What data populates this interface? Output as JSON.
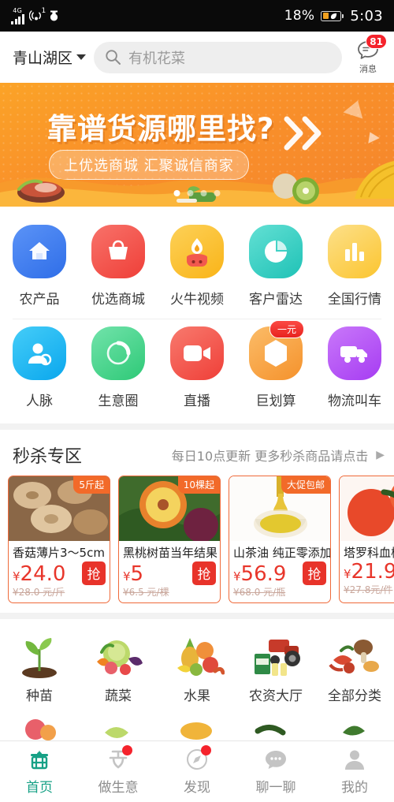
{
  "statusbar": {
    "network": "4G",
    "hotspot_count": "1",
    "battery_percent": "18%",
    "time": "5:03"
  },
  "header": {
    "location": "青山湖区",
    "location_caret_icon": "chevron-down-icon",
    "search_icon": "search-icon",
    "search_placeholder": "有机花菜",
    "search_value": "",
    "message_icon": "message-icon",
    "message_badge": "81",
    "message_label": "消息"
  },
  "banner": {
    "title": "靠谱货源哪里找?",
    "subtitle": "上优选商城 汇聚诚信商家",
    "arrow_icon": "double-chevron-right-icon",
    "dots": [
      "",
      "",
      "",
      ""
    ],
    "active_dot": 1,
    "bg_color": "#f9902a"
  },
  "quick_grid": {
    "rows": [
      [
        {
          "label": "农产品",
          "icon": "house-icon",
          "color1": "#3f7ff2",
          "color2": "#5b93f7"
        },
        {
          "label": "优选商城",
          "icon": "basket-icon",
          "color1": "#f4514a",
          "color2": "#f8726a"
        },
        {
          "label": "火牛视频",
          "icon": "bull-flame-icon",
          "color1": "#fcc223",
          "color2": "#fdd158"
        },
        {
          "label": "客户雷达",
          "icon": "pie-chart-icon",
          "color1": "#35d2c6",
          "color2": "#63e0d4"
        },
        {
          "label": "全国行情",
          "icon": "bar-chart-icon",
          "color1": "#fdcf3e",
          "color2": "#fde08a"
        }
      ],
      [
        {
          "label": "人脉",
          "icon": "contacts-icon",
          "color1": "#18b8f2",
          "color2": "#45cdf8"
        },
        {
          "label": "生意圈",
          "icon": "circle-ring-icon",
          "color1": "#3ed48a",
          "color2": "#72e3ab"
        },
        {
          "label": "直播",
          "icon": "video-camera-icon",
          "color1": "#f4514a",
          "color2": "#f87a6e"
        },
        {
          "label": "巨划算",
          "icon": "hexagon-icon",
          "color1": "#f79b39",
          "color2": "#fbbc68",
          "badge": "一元"
        },
        {
          "label": "物流叫车",
          "icon": "truck-icon",
          "color1": "#b14ff5",
          "color2": "#c978fa"
        }
      ]
    ]
  },
  "flash_sale": {
    "title": "秒杀专区",
    "subtitle": "每日10点更新 更多秒杀商品请点击",
    "arrow_icon": "chevron-right-icon",
    "buy_label": "抢",
    "items": [
      {
        "name": "香菇薄片3～5cm",
        "tag": "5斤起",
        "price": "24.0",
        "currency": "¥",
        "old_price": "¥28.0 元/斤",
        "img": "dried-mushroom-photo"
      },
      {
        "name": "黑桃树苗当年结果",
        "tag": "10棵起",
        "price": "5",
        "currency": "¥",
        "old_price": "¥6.5 元/棵",
        "img": "peach-photo"
      },
      {
        "name": "山茶油 纯正零添加",
        "tag": "大促包邮",
        "price": "56.9",
        "currency": "¥",
        "old_price": "¥68.0 元/瓶",
        "img": "camellia-oil-photo"
      },
      {
        "name": "塔罗科血橙",
        "tag": "",
        "price": "21.9",
        "currency": "¥",
        "old_price": "¥27.8元/件",
        "img": "blood-orange-photo"
      }
    ]
  },
  "categories": {
    "items": [
      {
        "label": "种苗",
        "icon": "seedling-photo"
      },
      {
        "label": "蔬菜",
        "icon": "vegetables-photo"
      },
      {
        "label": "水果",
        "icon": "fruits-photo"
      },
      {
        "label": "农资大厅",
        "icon": "tractor-photo"
      },
      {
        "label": "全部分类",
        "icon": "all-categories-photo"
      }
    ]
  },
  "tabbar": {
    "active_color": "#17a186",
    "items": [
      {
        "label": "首页",
        "icon": "home-icon",
        "active": true,
        "badge": false
      },
      {
        "label": "做生意",
        "icon": "sell-icon",
        "active": false,
        "badge": true
      },
      {
        "label": "发现",
        "icon": "discover-icon",
        "active": false,
        "badge": true
      },
      {
        "label": "聊一聊",
        "icon": "chat-icon",
        "active": false,
        "badge": false
      },
      {
        "label": "我的",
        "icon": "person-icon",
        "active": false,
        "badge": false
      }
    ]
  }
}
